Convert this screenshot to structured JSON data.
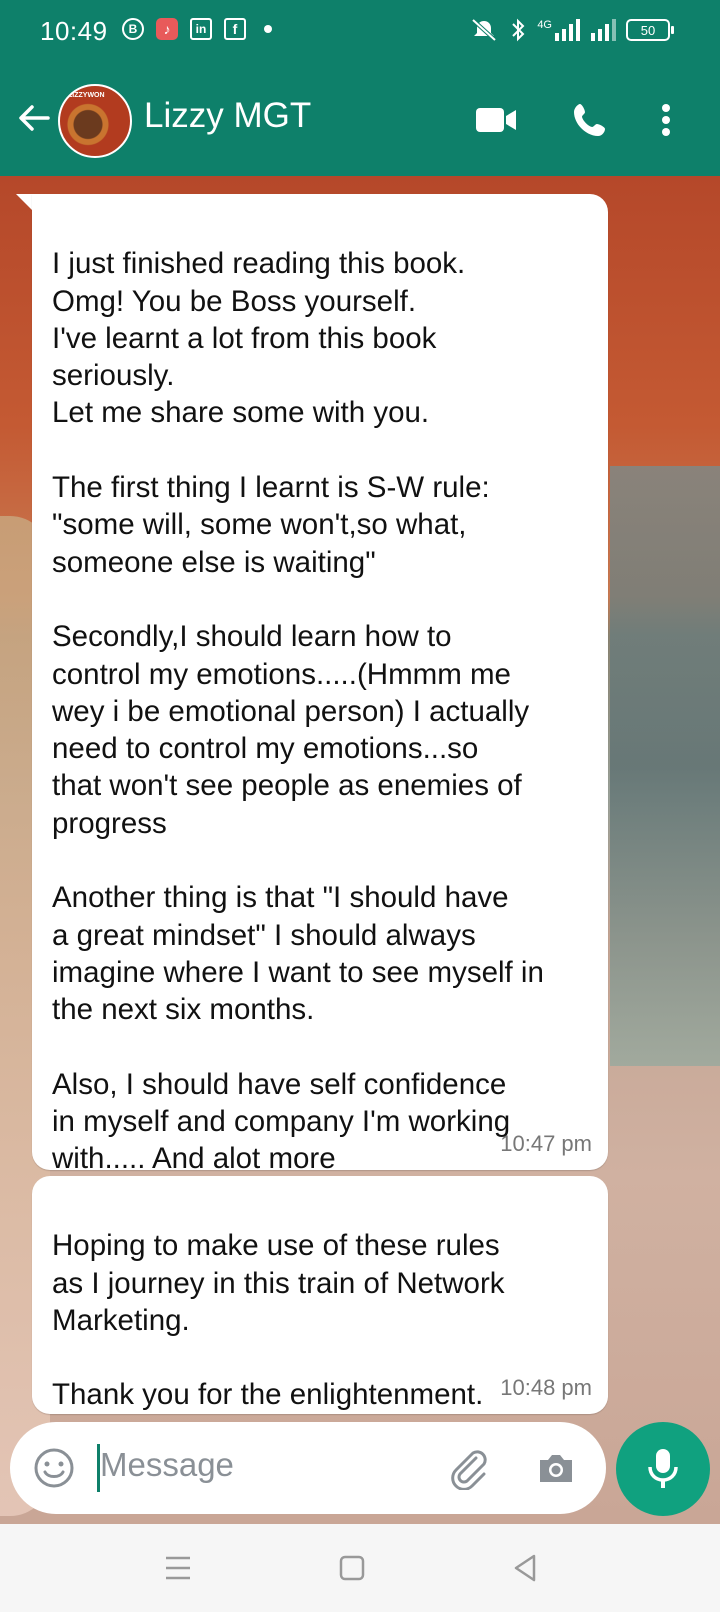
{
  "status_bar": {
    "time": "10:49",
    "icons": [
      "B",
      "♪",
      "in",
      "f"
    ],
    "network": "4G",
    "battery": "50"
  },
  "header": {
    "contact_name": "Lizzy MGT",
    "avatar_text": "LIZZYWON"
  },
  "messages": [
    {
      "text": "I just finished reading this book.\nOmg! You be Boss yourself.\nI've learnt a lot from this book\nseriously.\nLet me share some with you.\n\nThe first thing I learnt is S-W rule:\n\"some will, some won't,so what,\nsomeone else is waiting\"\n\nSecondly,I should learn how to\ncontrol my emotions.....(Hmmm me\nwey i be emotional person) I actually\nneed to control my emotions...so\nthat won't see people as enemies of\nprogress\n\nAnother thing is that \"I should have\na great mindset\" I should always\nimagine where I want to see myself in\nthe next six months.\n\nAlso, I should have self confidence\nin myself and company I'm working\nwith..... And alot more",
      "time": "10:47 pm"
    },
    {
      "text": "Hoping to make use of these rules\nas I journey in this train of Network\nMarketing.\n\nThank you for the enlightenment.",
      "time": "10:48 pm"
    }
  ],
  "input": {
    "placeholder": "Message"
  },
  "colors": {
    "header": "#0e806a",
    "mic_button": "#10a17f",
    "bubble": "#ffffff"
  },
  "icons": [
    "back-arrow-icon",
    "video-call-icon",
    "phone-icon",
    "more-vert-icon",
    "emoji-icon",
    "attach-icon",
    "camera-icon",
    "mic-icon",
    "menu-icon",
    "home-icon",
    "back-icon"
  ]
}
